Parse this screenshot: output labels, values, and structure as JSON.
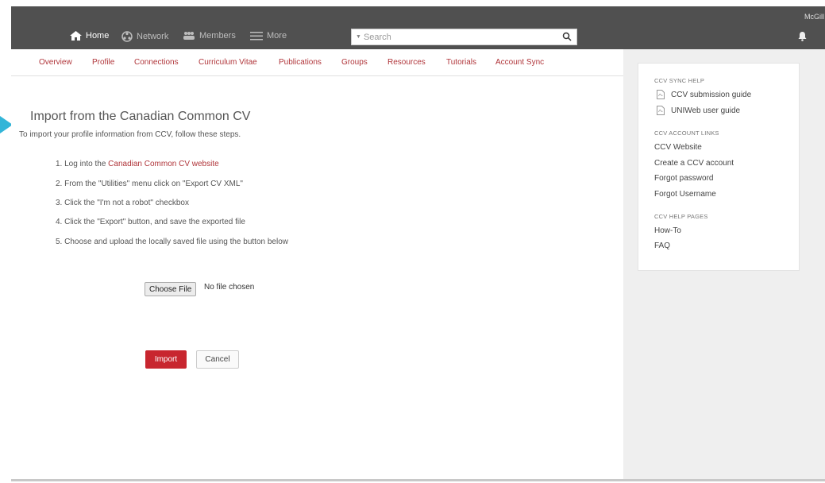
{
  "topbar": {
    "nav": [
      {
        "label": "Home",
        "icon": "home-icon",
        "active": true
      },
      {
        "label": "Network",
        "icon": "network-icon",
        "active": false
      },
      {
        "label": "Members",
        "icon": "members-icon",
        "active": false
      },
      {
        "label": "More",
        "icon": "menu-icon",
        "active": false
      }
    ],
    "search_placeholder": "Search",
    "user_name": "McGill Ho",
    "bar_color": "#505050"
  },
  "tabs": [
    "Overview",
    "Profile",
    "Connections",
    "Curriculum Vitae",
    "Publications",
    "Groups",
    "Resources",
    "Tutorials",
    "Account Sync"
  ],
  "main": {
    "title": "Import from the Canadian Common CV",
    "intro": "To import your profile information from CCV, follow these steps.",
    "steps": [
      {
        "prefix": "1. Log into the ",
        "link": "Canadian Common CV website"
      },
      {
        "text": "2. From the \"Utilities\" menu click on \"Export CV XML\""
      },
      {
        "text": "3. Click the \"I'm not a robot\" checkbox"
      },
      {
        "text": "4. Click the \"Export\" button, and save the exported file"
      },
      {
        "text": "5. Choose and upload the locally saved file using the button below"
      }
    ],
    "choose_file_label": "Choose File",
    "no_file_text": "No file chosen",
    "import_label": "Import",
    "cancel_label": "Cancel",
    "accent_color": "#c8262f",
    "link_color": "#b0353a"
  },
  "sidebar": {
    "sync_help_heading": "CCV SYNC HELP",
    "docs": [
      "CCV submission guide",
      "UNIWeb user guide"
    ],
    "account_links_heading": "CCV ACCOUNT LINKS",
    "account_links": [
      "CCV Website",
      "Create a CCV account",
      "Forgot password",
      "Forgot Username"
    ],
    "help_pages_heading": "CCV HELP PAGES",
    "help_pages": [
      "How-To",
      "FAQ"
    ]
  }
}
